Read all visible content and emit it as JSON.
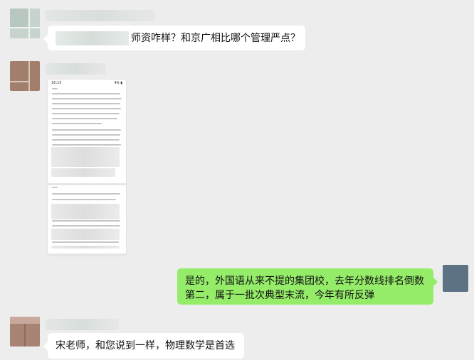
{
  "messages": [
    {
      "id": "m1",
      "side": "left",
      "text": "师资咋样？和京广相比哪个管理严点？",
      "has_redacted_prefix": true
    },
    {
      "id": "m2",
      "side": "left",
      "type": "image",
      "status_time": "16:15",
      "status_icons": "4G ▮"
    },
    {
      "id": "m3",
      "side": "right",
      "text": "是的，外国语从来不提的集团校，去年分数线排名倒数第二，属于一批次典型末流，今年有所反弹"
    },
    {
      "id": "m4",
      "side": "left",
      "text": "宋老师，和您说到一样，物理数学是首选"
    }
  ],
  "colors": {
    "background": "#ededed",
    "incoming_bubble": "#ffffff",
    "outgoing_bubble": "#95ec69"
  },
  "icons": {
    "avatars": [
      "avatar-sender-1",
      "avatar-sender-2",
      "avatar-self",
      "avatar-sender-3"
    ]
  }
}
